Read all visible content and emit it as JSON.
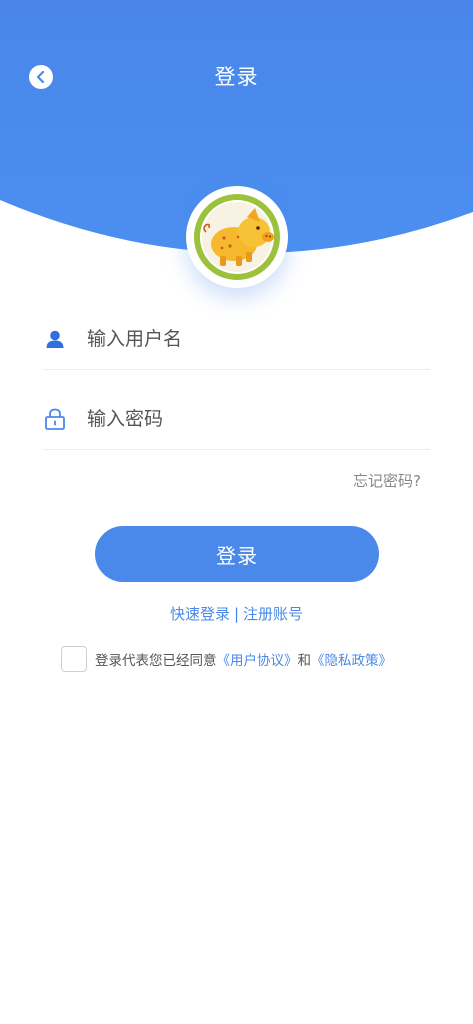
{
  "colors": {
    "primary": "#4a89ea",
    "header_top": "#4a86ea",
    "header_bottom": "#4b8ff0",
    "text_muted": "#888888",
    "divider": "#ececec"
  },
  "header": {
    "title": "登录",
    "back_icon": "chevron-left-icon"
  },
  "avatar": {
    "icon": "pig-logo-icon"
  },
  "form": {
    "username": {
      "icon": "user-icon",
      "placeholder": "输入用户名",
      "value": ""
    },
    "password": {
      "icon": "lock-icon",
      "placeholder": "输入密码",
      "value": ""
    },
    "forgot_label": "忘记密码?"
  },
  "actions": {
    "login_label": "登录",
    "quick_login_label": "快速登录",
    "separator": "|",
    "register_label": "注册账号"
  },
  "agreement": {
    "checked": false,
    "prefix": "登录代表您已经同意",
    "user_agreement": "《用户协议》",
    "conjunction": "和",
    "privacy_policy": "《隐私政策》"
  }
}
